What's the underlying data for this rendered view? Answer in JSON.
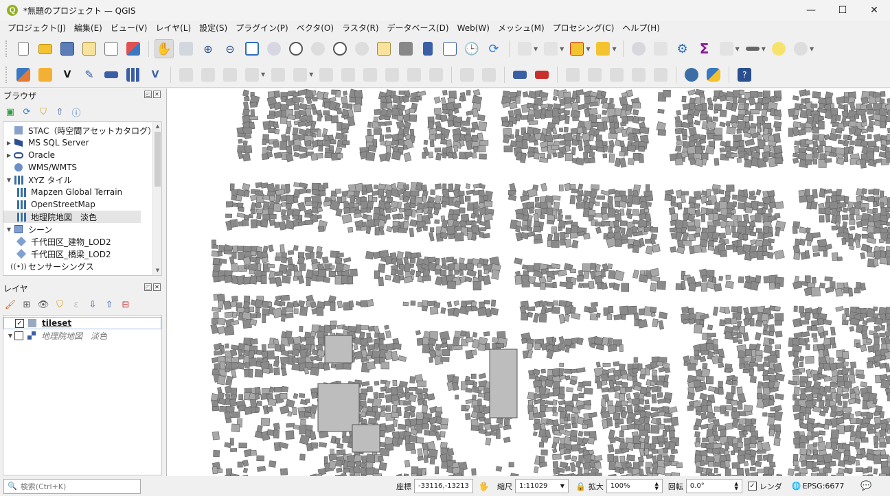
{
  "window": {
    "title": "*無題のプロジェクト — QGIS",
    "logo_letter": "Q",
    "controls": [
      "—",
      "☐",
      "✕"
    ]
  },
  "menubar": {
    "items": [
      "プロジェクト(J)",
      "編集(E)",
      "ビュー(V)",
      "レイヤ(L)",
      "設定(S)",
      "プラグイン(P)",
      "ベクタ(O)",
      "ラスタ(R)",
      "データベース(D)",
      "Web(W)",
      "メッシュ(M)",
      "プロセシング(C)",
      "ヘルプ(H)"
    ]
  },
  "browser_panel": {
    "title": "ブラウザ",
    "items": [
      {
        "label": "STAC（時空間アセットカタログ）",
        "indent": 0,
        "arrow": "",
        "icon": "stac-icon"
      },
      {
        "label": "MS SQL Server",
        "indent": 0,
        "arrow": "▶",
        "icon": "mssql-icon"
      },
      {
        "label": "Oracle",
        "indent": 0,
        "arrow": "▶",
        "icon": "oracle-icon"
      },
      {
        "label": "WMS/WMTS",
        "indent": 0,
        "arrow": "",
        "icon": "globe-icon"
      },
      {
        "label": "XYZ タイル",
        "indent": 0,
        "arrow": "▼",
        "icon": "grid-icon"
      },
      {
        "label": "Mapzen Global Terrain",
        "indent": 1,
        "arrow": "",
        "icon": "grid-icon"
      },
      {
        "label": "OpenStreetMap",
        "indent": 1,
        "arrow": "",
        "icon": "grid-icon"
      },
      {
        "label": "地理院地図　淡色",
        "indent": 1,
        "arrow": "",
        "icon": "grid-icon",
        "selected": true
      },
      {
        "label": "シーン",
        "indent": 0,
        "arrow": "▼",
        "icon": "cube-icon"
      },
      {
        "label": "千代田区_建物_LOD2",
        "indent": 1,
        "arrow": "",
        "icon": "diamond-icon"
      },
      {
        "label": "千代田区_橋梁_LOD2",
        "indent": 1,
        "arrow": "",
        "icon": "diamond-icon"
      },
      {
        "label": "センサーシングス",
        "indent": 0,
        "arrow": "",
        "icon": "sensor-icon"
      }
    ]
  },
  "layers_panel": {
    "title": "レイヤ",
    "items": [
      {
        "label": "tileset",
        "checked": true,
        "arrow": "",
        "style": "bold"
      },
      {
        "label": "地理院地図　淡色",
        "checked": false,
        "arrow": "▼",
        "style": "italic"
      }
    ]
  },
  "statusbar": {
    "search_placeholder": "検索(Ctrl+K)",
    "coord_label": "座標",
    "coord_value": "-33116,-13213",
    "scale_label": "縮尺",
    "scale_value": "1:11029",
    "magnify_label": "拡大",
    "magnify_value": "100%",
    "rotation_label": "回転",
    "rotation_value": "0.0°",
    "render_label": "レンダ",
    "render_checked": true,
    "crs_value": "EPSG:6677"
  },
  "colors": {
    "accent_green": "#93b023",
    "building_fill": "#8a8a8a",
    "road_white": "#ffffff"
  }
}
